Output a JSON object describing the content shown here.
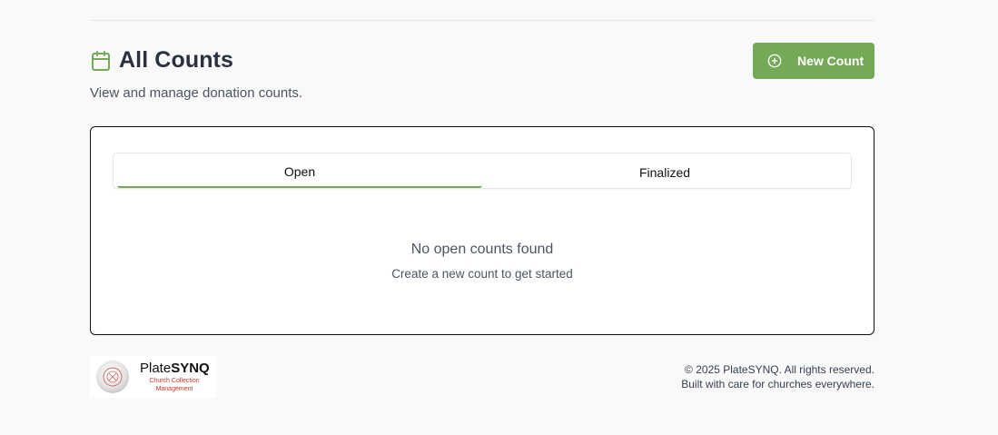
{
  "page": {
    "title": "All Counts",
    "subtitle": "View and manage donation counts.",
    "title_icon": "calendar-icon",
    "accent_color": "#74a957"
  },
  "actions": {
    "new_count_label": "New Count",
    "new_count_icon": "plus-circle-icon"
  },
  "tabs": [
    {
      "label": "Open",
      "active": true
    },
    {
      "label": "Finalized",
      "active": false
    }
  ],
  "empty_state": {
    "title": "No open counts found",
    "subtitle": "Create a new count to get started"
  },
  "footer": {
    "logo_name_prefix": "Plate",
    "logo_name_bold": "SYNQ",
    "logo_tagline": "Church Collection Management",
    "copyright": "© 2025 PlateSYNQ. All rights reserved.",
    "tagline": "Built with care for churches everywhere."
  }
}
